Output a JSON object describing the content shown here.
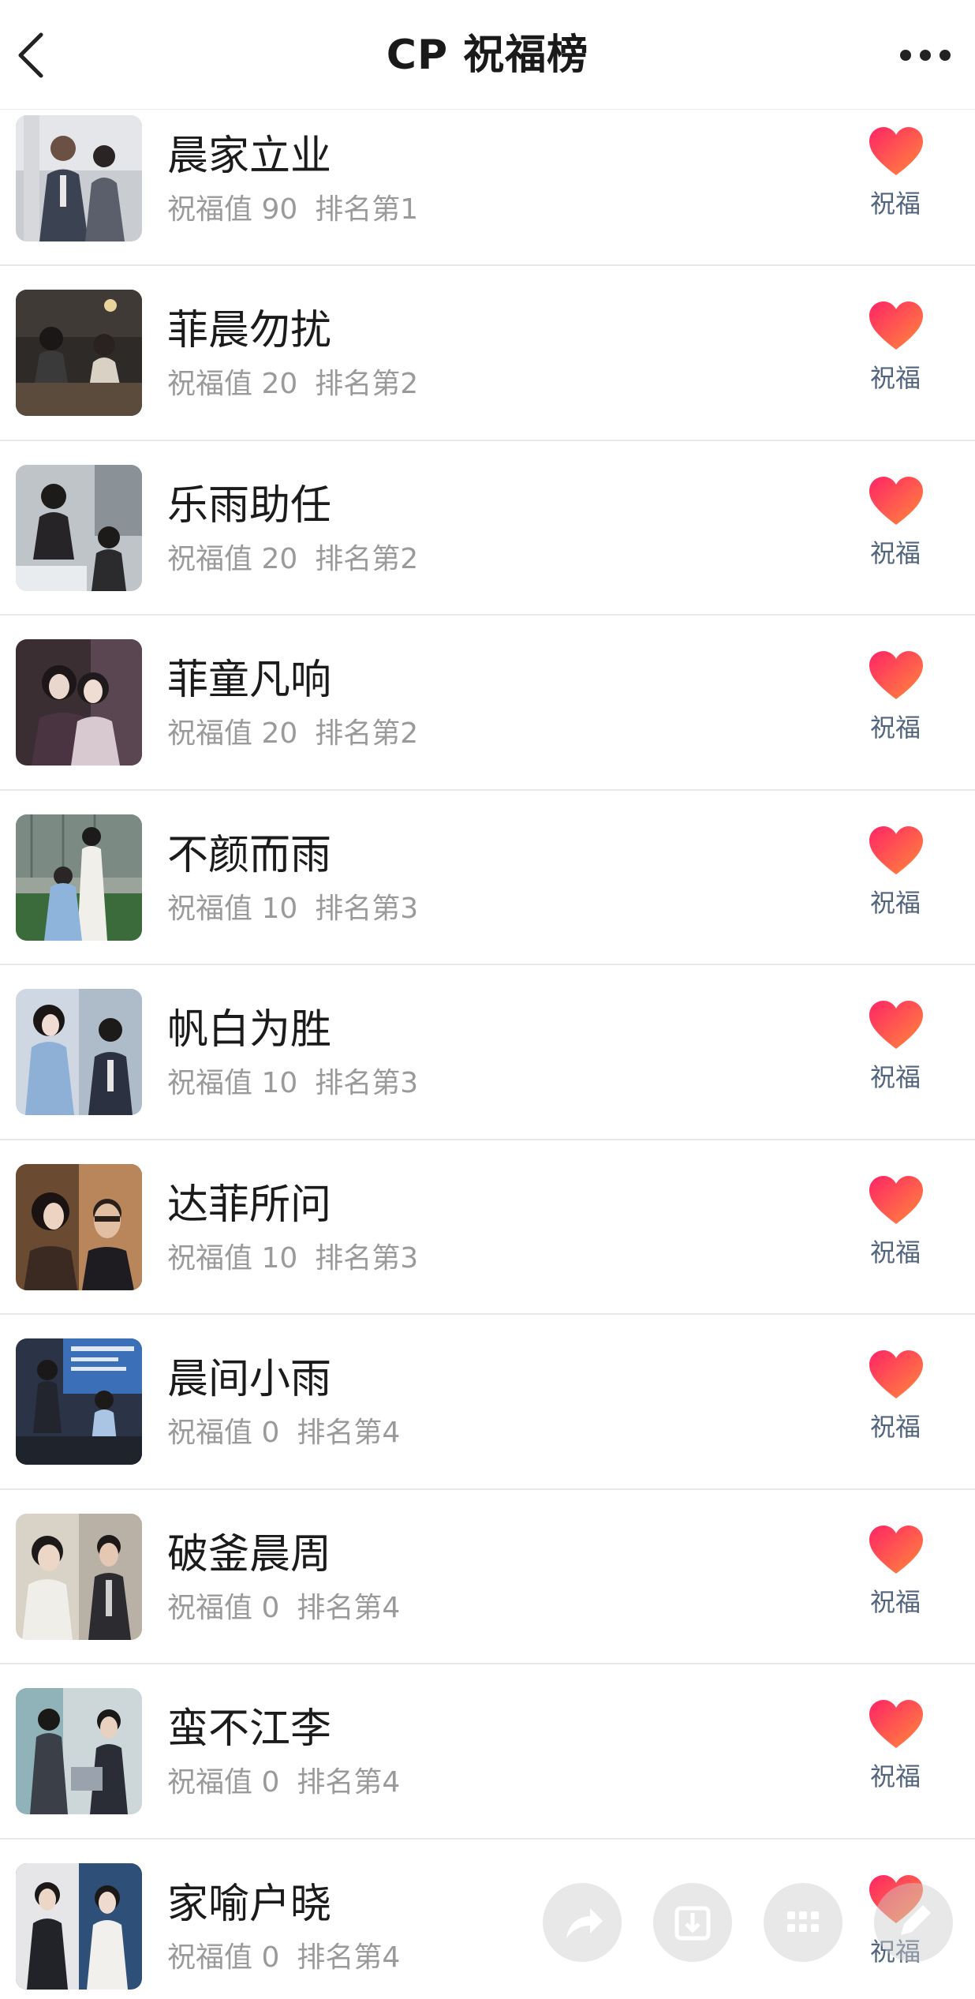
{
  "header": {
    "title": "CP 祝福榜",
    "back_icon": "chevron-left-icon",
    "more_icon": "more-horizontal-icon"
  },
  "colors": {
    "heart_top": "#ff2e6a",
    "heart_bottom": "#ff7a3d",
    "bless_label": "#53657e",
    "meta_text": "#9a9a9a"
  },
  "list": [
    {
      "name": "晨家立业",
      "value_label": "祝福值 90",
      "rank_label": "排名第1",
      "action_label": "祝福"
    },
    {
      "name": "菲晨勿扰",
      "value_label": "祝福值 20",
      "rank_label": "排名第2",
      "action_label": "祝福"
    },
    {
      "name": "乐雨助任",
      "value_label": "祝福值 20",
      "rank_label": "排名第2",
      "action_label": "祝福"
    },
    {
      "name": "菲童凡响",
      "value_label": "祝福值 20",
      "rank_label": "排名第2",
      "action_label": "祝福"
    },
    {
      "name": "不颜而雨",
      "value_label": "祝福值 10",
      "rank_label": "排名第3",
      "action_label": "祝福"
    },
    {
      "name": "帆白为胜",
      "value_label": "祝福值 10",
      "rank_label": "排名第3",
      "action_label": "祝福"
    },
    {
      "name": "达菲所问",
      "value_label": "祝福值 10",
      "rank_label": "排名第3",
      "action_label": "祝福"
    },
    {
      "name": "晨间小雨",
      "value_label": "祝福值 0",
      "rank_label": "排名第4",
      "action_label": "祝福"
    },
    {
      "name": "破釜晨周",
      "value_label": "祝福值 0",
      "rank_label": "排名第4",
      "action_label": "祝福"
    },
    {
      "name": "蛮不江李",
      "value_label": "祝福值 0",
      "rank_label": "排名第4",
      "action_label": "祝福"
    },
    {
      "name": "家喻户晓",
      "value_label": "祝福值 0",
      "rank_label": "排名第4",
      "action_label": "祝福"
    }
  ],
  "floating_actions": [
    {
      "icon": "share-icon"
    },
    {
      "icon": "download-icon"
    },
    {
      "icon": "grid-icon"
    },
    {
      "icon": "edit-icon"
    }
  ]
}
